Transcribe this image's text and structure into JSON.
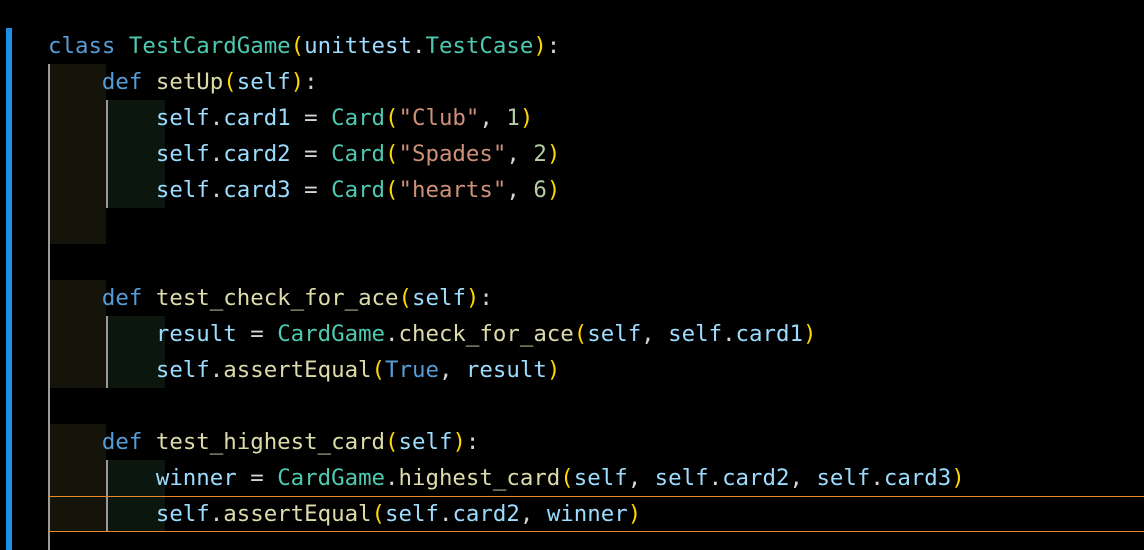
{
  "code_lines": [
    {
      "tokens": [
        [
          "kw",
          "class"
        ],
        [
          "pl",
          " "
        ],
        [
          "cls",
          "TestCardGame"
        ],
        [
          "br",
          "("
        ],
        [
          "var",
          "unittest"
        ],
        [
          "pl",
          "."
        ],
        [
          "cls",
          "TestCase"
        ],
        [
          "br",
          ")"
        ],
        [
          "pl",
          ":"
        ]
      ]
    },
    {
      "tokens": [
        [
          "pl",
          "    "
        ],
        [
          "kw",
          "def"
        ],
        [
          "pl",
          " "
        ],
        [
          "fn",
          "setUp"
        ],
        [
          "br",
          "("
        ],
        [
          "var",
          "self"
        ],
        [
          "br",
          ")"
        ],
        [
          "pl",
          ":"
        ]
      ]
    },
    {
      "tokens": [
        [
          "pl",
          "        "
        ],
        [
          "var",
          "self"
        ],
        [
          "pl",
          "."
        ],
        [
          "var",
          "card1"
        ],
        [
          "pl",
          " = "
        ],
        [
          "cls",
          "Card"
        ],
        [
          "br",
          "("
        ],
        [
          "str",
          "\"Club\""
        ],
        [
          "pl",
          ", "
        ],
        [
          "num",
          "1"
        ],
        [
          "br",
          ")"
        ]
      ]
    },
    {
      "tokens": [
        [
          "pl",
          "        "
        ],
        [
          "var",
          "self"
        ],
        [
          "pl",
          "."
        ],
        [
          "var",
          "card2"
        ],
        [
          "pl",
          " = "
        ],
        [
          "cls",
          "Card"
        ],
        [
          "br",
          "("
        ],
        [
          "str",
          "\"Spades\""
        ],
        [
          "pl",
          ", "
        ],
        [
          "num",
          "2"
        ],
        [
          "br",
          ")"
        ]
      ]
    },
    {
      "tokens": [
        [
          "pl",
          "        "
        ],
        [
          "var",
          "self"
        ],
        [
          "pl",
          "."
        ],
        [
          "var",
          "card3"
        ],
        [
          "pl",
          " = "
        ],
        [
          "cls",
          "Card"
        ],
        [
          "br",
          "("
        ],
        [
          "str",
          "\"hearts\""
        ],
        [
          "pl",
          ", "
        ],
        [
          "num",
          "6"
        ],
        [
          "br",
          ")"
        ]
      ]
    },
    {
      "tokens": []
    },
    {
      "tokens": []
    },
    {
      "tokens": [
        [
          "pl",
          "    "
        ],
        [
          "kw",
          "def"
        ],
        [
          "pl",
          " "
        ],
        [
          "fn",
          "test_check_for_ace"
        ],
        [
          "br",
          "("
        ],
        [
          "var",
          "self"
        ],
        [
          "br",
          ")"
        ],
        [
          "pl",
          ":"
        ]
      ]
    },
    {
      "tokens": [
        [
          "pl",
          "        "
        ],
        [
          "var",
          "result"
        ],
        [
          "pl",
          " = "
        ],
        [
          "cls",
          "CardGame"
        ],
        [
          "pl",
          "."
        ],
        [
          "fn",
          "check_for_ace"
        ],
        [
          "br",
          "("
        ],
        [
          "var",
          "self"
        ],
        [
          "pl",
          ", "
        ],
        [
          "var",
          "self"
        ],
        [
          "pl",
          "."
        ],
        [
          "var",
          "card1"
        ],
        [
          "br",
          ")"
        ]
      ]
    },
    {
      "tokens": [
        [
          "pl",
          "        "
        ],
        [
          "var",
          "self"
        ],
        [
          "pl",
          "."
        ],
        [
          "fn",
          "assertEqual"
        ],
        [
          "br",
          "("
        ],
        [
          "kw",
          "True"
        ],
        [
          "pl",
          ", "
        ],
        [
          "var",
          "result"
        ],
        [
          "br",
          ")"
        ]
      ]
    },
    {
      "tokens": []
    },
    {
      "tokens": [
        [
          "pl",
          "    "
        ],
        [
          "kw",
          "def"
        ],
        [
          "pl",
          " "
        ],
        [
          "fn",
          "test_highest_card"
        ],
        [
          "br",
          "("
        ],
        [
          "var",
          "self"
        ],
        [
          "br",
          ")"
        ],
        [
          "pl",
          ":"
        ]
      ]
    },
    {
      "tokens": [
        [
          "pl",
          "        "
        ],
        [
          "var",
          "winner"
        ],
        [
          "pl",
          " = "
        ],
        [
          "cls",
          "CardGame"
        ],
        [
          "pl",
          "."
        ],
        [
          "fn",
          "highest_card"
        ],
        [
          "br",
          "("
        ],
        [
          "var",
          "self"
        ],
        [
          "pl",
          ", "
        ],
        [
          "var",
          "self"
        ],
        [
          "pl",
          "."
        ],
        [
          "var",
          "card2"
        ],
        [
          "pl",
          ", "
        ],
        [
          "var",
          "self"
        ],
        [
          "pl",
          "."
        ],
        [
          "var",
          "card3"
        ],
        [
          "br",
          ")"
        ]
      ]
    },
    {
      "tokens": [
        [
          "pl",
          "        "
        ],
        [
          "var",
          "self"
        ],
        [
          "pl",
          "."
        ],
        [
          "fn",
          "assertEqual"
        ],
        [
          "br",
          "("
        ],
        [
          "var",
          "self"
        ],
        [
          "pl",
          "."
        ],
        [
          "var",
          "card2"
        ],
        [
          "pl",
          ", "
        ],
        [
          "var",
          "winner"
        ],
        [
          "br",
          ")"
        ]
      ]
    }
  ]
}
